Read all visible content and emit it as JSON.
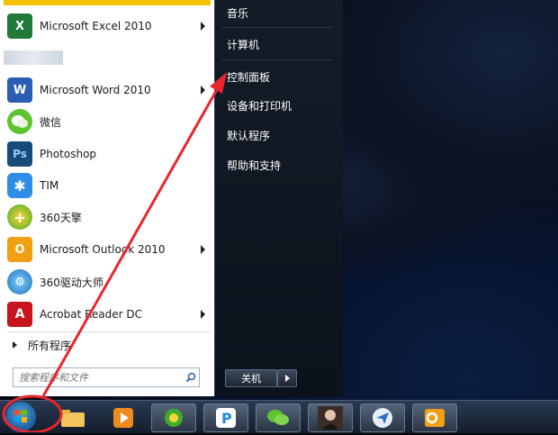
{
  "start_menu": {
    "programs": [
      {
        "label": "Microsoft Excel 2010",
        "icon": "excel-icon",
        "has_submenu": true
      },
      {
        "label": "Microsoft Word 2010",
        "icon": "word-icon",
        "has_submenu": true
      },
      {
        "label": "微信",
        "icon": "wechat-icon",
        "has_submenu": false
      },
      {
        "label": "Photoshop",
        "icon": "photoshop-icon",
        "has_submenu": false
      },
      {
        "label": "TIM",
        "icon": "tim-icon",
        "has_submenu": false
      },
      {
        "label": "360天擎",
        "icon": "360-tianqing-icon",
        "has_submenu": false
      },
      {
        "label": "Microsoft Outlook 2010",
        "icon": "outlook-icon",
        "has_submenu": true
      },
      {
        "label": "360驱动大师",
        "icon": "360-driver-icon",
        "has_submenu": false
      },
      {
        "label": "Acrobat Reader DC",
        "icon": "acrobat-icon",
        "has_submenu": true
      }
    ],
    "all_programs": "所有程序",
    "search_placeholder": "搜索程序和文件",
    "right_items": [
      "音乐",
      "计算机",
      "控制面板",
      "设备和打印机",
      "默认程序",
      "帮助和支持"
    ],
    "shutdown_label": "关机"
  },
  "colors": {
    "annotation": "#e8262d",
    "start_panel_bg": "#ffffff",
    "right_panel_bg": "#141c28"
  }
}
